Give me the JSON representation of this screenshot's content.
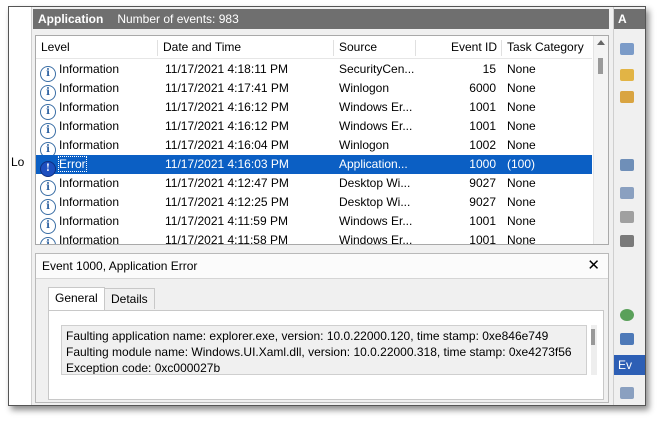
{
  "left_panel": {
    "label": "Lo"
  },
  "header": {
    "log_name": "Application",
    "event_count": "Number of events: 983"
  },
  "columns": [
    "Level",
    "Date and Time",
    "Source",
    "Event ID",
    "Task Category"
  ],
  "events": [
    {
      "level": "Information",
      "datetime": "11/17/2021 4:18:11 PM",
      "source": "SecurityCen...",
      "event_id": "15",
      "task": "None",
      "selected": false
    },
    {
      "level": "Information",
      "datetime": "11/17/2021 4:17:41 PM",
      "source": "Winlogon",
      "event_id": "6000",
      "task": "None",
      "selected": false
    },
    {
      "level": "Information",
      "datetime": "11/17/2021 4:16:12 PM",
      "source": "Windows Er...",
      "event_id": "1001",
      "task": "None",
      "selected": false
    },
    {
      "level": "Information",
      "datetime": "11/17/2021 4:16:12 PM",
      "source": "Windows Er...",
      "event_id": "1001",
      "task": "None",
      "selected": false
    },
    {
      "level": "Information",
      "datetime": "11/17/2021 4:16:04 PM",
      "source": "Winlogon",
      "event_id": "1002",
      "task": "None",
      "selected": false
    },
    {
      "level": "Error",
      "datetime": "11/17/2021 4:16:03 PM",
      "source": "Application...",
      "event_id": "1000",
      "task": "(100)",
      "selected": true
    },
    {
      "level": "Information",
      "datetime": "11/17/2021 4:12:47 PM",
      "source": "Desktop Wi...",
      "event_id": "9027",
      "task": "None",
      "selected": false
    },
    {
      "level": "Information",
      "datetime": "11/17/2021 4:12:25 PM",
      "source": "Desktop Wi...",
      "event_id": "9027",
      "task": "None",
      "selected": false
    },
    {
      "level": "Information",
      "datetime": "11/17/2021 4:11:59 PM",
      "source": "Windows Er...",
      "event_id": "1001",
      "task": "None",
      "selected": false
    },
    {
      "level": "Information",
      "datetime": "11/17/2021 4:11:58 PM",
      "source": "Windows Er...",
      "event_id": "1001",
      "task": "None",
      "selected": false
    }
  ],
  "detail": {
    "title": "Event 1000, Application Error",
    "close_glyph": "✕",
    "tabs": [
      "General",
      "Details"
    ],
    "active_tab": "General",
    "lines": [
      "Faulting application name: explorer.exe, version: 10.0.22000.120, time stamp: 0xe846e749",
      "Faulting module name: Windows.UI.Xaml.dll, version: 10.0.22000.318, time stamp: 0xe4273f56",
      "Exception code: 0xc000027b"
    ]
  },
  "actions_panel": {
    "header": "A",
    "highlight_label": "Ev"
  },
  "icons": {
    "info": "information-icon",
    "error": "error-icon"
  },
  "colors": {
    "selection": "#0b5fc4",
    "title_bar": "#6f6f6f"
  }
}
